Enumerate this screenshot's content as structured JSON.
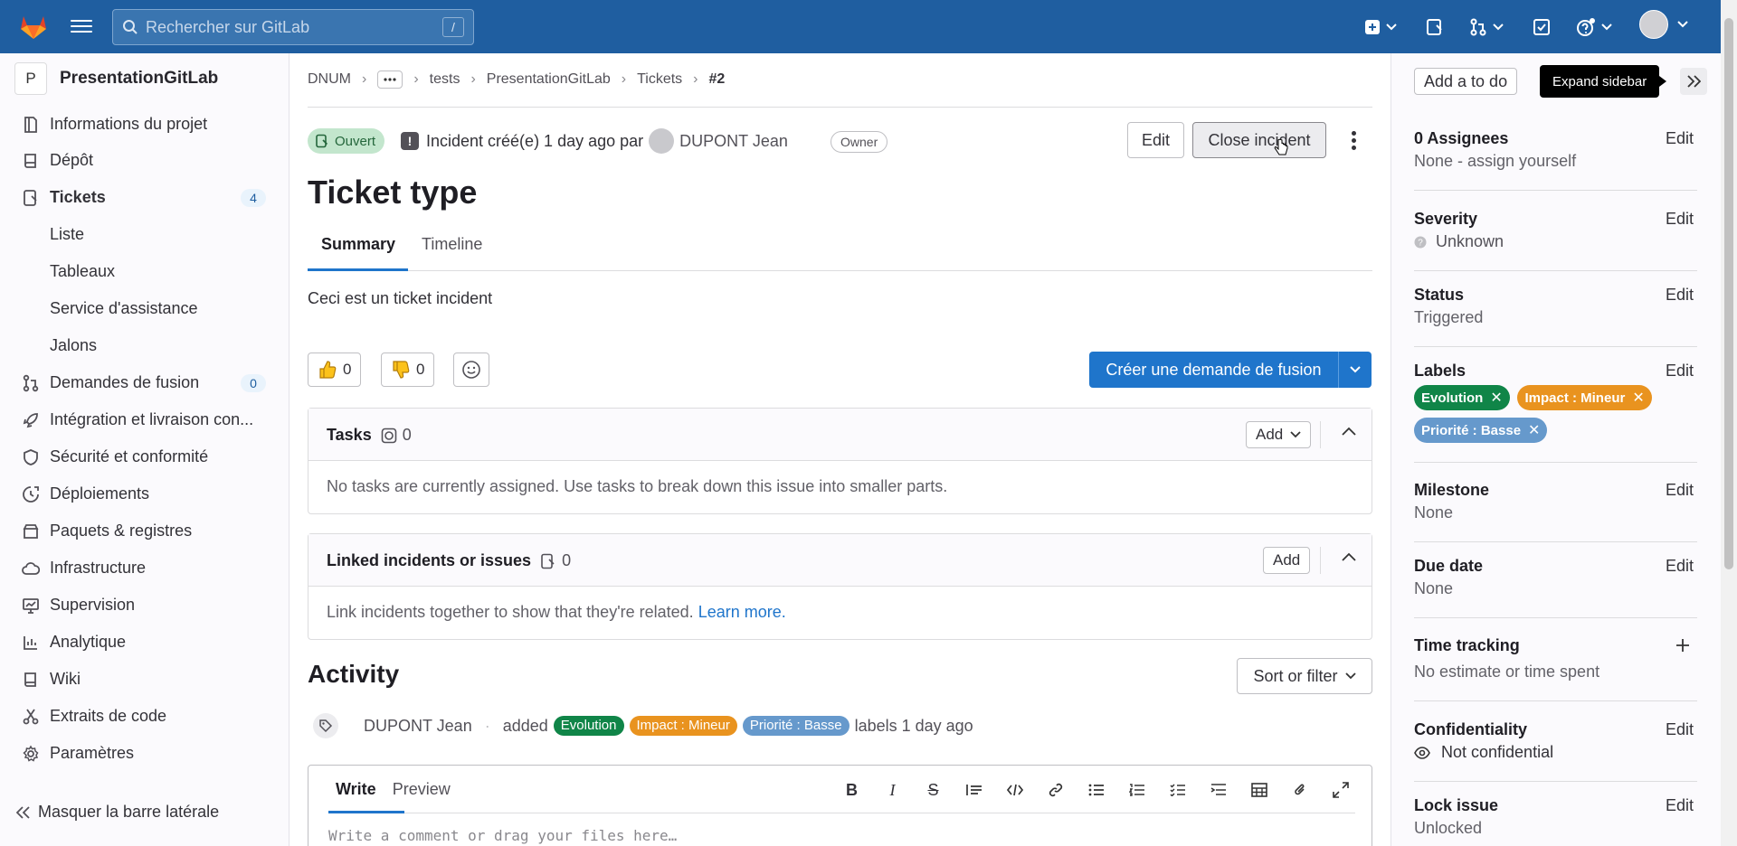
{
  "topbar": {
    "search_placeholder": "Rechercher sur GitLab",
    "search_shortcut": "/"
  },
  "sidebar": {
    "project_initial": "P",
    "project_name": "PresentationGitLab",
    "items": [
      {
        "label": "Informations du projet",
        "icon": "info-icon"
      },
      {
        "label": "Dépôt",
        "icon": "repo-icon"
      },
      {
        "label": "Tickets",
        "icon": "issues-icon",
        "badge": "4",
        "active": true
      },
      {
        "label": "Liste"
      },
      {
        "label": "Tableaux"
      },
      {
        "label": "Service d'assistance"
      },
      {
        "label": "Jalons"
      },
      {
        "label": "Demandes de fusion",
        "icon": "merge-request-icon",
        "badge": "0"
      },
      {
        "label": "Intégration et livraison con...",
        "icon": "rocket-icon"
      },
      {
        "label": "Sécurité et conformité",
        "icon": "shield-icon"
      },
      {
        "label": "Déploiements",
        "icon": "deployments-icon"
      },
      {
        "label": "Paquets & registres",
        "icon": "package-icon"
      },
      {
        "label": "Infrastructure",
        "icon": "cloud-icon"
      },
      {
        "label": "Supervision",
        "icon": "monitor-icon"
      },
      {
        "label": "Analytique",
        "icon": "chart-icon"
      },
      {
        "label": "Wiki",
        "icon": "book-icon"
      },
      {
        "label": "Extraits de code",
        "icon": "snippet-icon"
      },
      {
        "label": "Paramètres",
        "icon": "gear-icon"
      }
    ],
    "collapse_label": "Masquer la barre latérale"
  },
  "breadcrumb": [
    "DNUM",
    "tests",
    "PresentationGitLab",
    "Tickets",
    "#2"
  ],
  "issue": {
    "status": "Ouvert",
    "meta_prefix": "Incident créé(e) 1 day ago par",
    "author": "DUPONT Jean",
    "role_badge": "Owner",
    "edit_label": "Edit",
    "close_label": "Close incident",
    "title": "Ticket type",
    "tabs": [
      "Summary",
      "Timeline"
    ],
    "description": "Ceci est un ticket incident",
    "thumbs_up": "0",
    "thumbs_down": "0",
    "create_mr_label": "Créer une demande de fusion"
  },
  "tasks": {
    "title": "Tasks",
    "count": "0",
    "add_label": "Add",
    "empty_text": "No tasks are currently assigned. Use tasks to break down this issue into smaller parts."
  },
  "linked": {
    "title": "Linked incidents or issues",
    "count": "0",
    "add_label": "Add",
    "empty_text": "Link incidents together to show that they're related.",
    "learn_more": "Learn more."
  },
  "activity": {
    "title": "Activity",
    "sort_label": "Sort or filter",
    "author": "DUPONT Jean",
    "action": "added",
    "labels": [
      {
        "name": "Evolution",
        "color": "#108548"
      },
      {
        "name": "Impact : Mineur",
        "color": "#e9931f"
      },
      {
        "name": "Priorité : Basse",
        "color": "#6699cc"
      }
    ],
    "suffix": "labels 1 day ago"
  },
  "editor": {
    "tabs": [
      "Write",
      "Preview"
    ],
    "placeholder": "Write a comment or drag your files here…"
  },
  "right_sidebar": {
    "todo_label": "Add a to do",
    "tooltip": "Expand sidebar",
    "edit_label": "Edit",
    "assignees_title": "0 Assignees",
    "assignees_value": "None - assign yourself",
    "severity_title": "Severity",
    "severity_value": "Unknown",
    "status_title": "Status",
    "status_value": "Triggered",
    "labels_title": "Labels",
    "labels": [
      {
        "name": "Evolution",
        "color": "#108548"
      },
      {
        "name": "Impact : Mineur",
        "color": "#e9931f"
      },
      {
        "name": "Priorité : Basse",
        "color": "#6699cc"
      }
    ],
    "milestone_title": "Milestone",
    "milestone_value": "None",
    "due_title": "Due date",
    "due_value": "None",
    "time_title": "Time tracking",
    "time_value": "No estimate or time spent",
    "conf_title": "Confidentiality",
    "conf_value": "Not confidential",
    "lock_title": "Lock issue",
    "lock_value": "Unlocked"
  },
  "colors": {
    "topbar": "#1f5ea0",
    "primary": "#1f75cb",
    "open_badge_bg": "#c3e6cd"
  }
}
